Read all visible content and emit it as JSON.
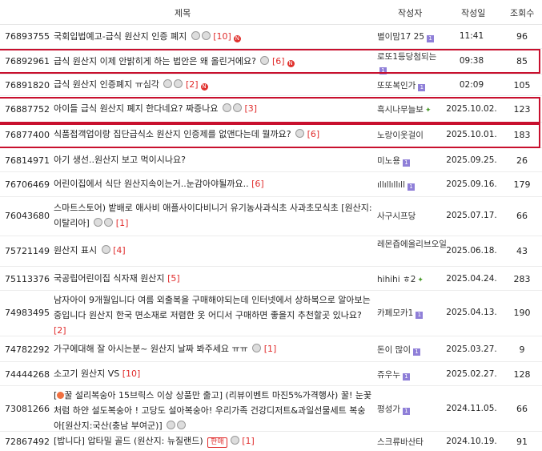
{
  "header": {
    "title": "제목",
    "author": "작성자",
    "date": "작성일",
    "views": "조회수"
  },
  "rows": [
    {
      "num": "76893755",
      "title": "국회입법예고-급식 원산지 인증 폐지",
      "comments": "[10]",
      "author": "별이맘17 25",
      "date": "11:41",
      "views": "96"
    },
    {
      "num": "76892961",
      "title": "급식 원산지 이제 안밝히게 하는 법안은 왜 올린거에요?",
      "comments": "[6]",
      "author": "로또1등당첨되는",
      "date": "09:38",
      "views": "85"
    },
    {
      "num": "76891820",
      "title": "급식 원산지 인증폐지 ㅠ심각",
      "comments": "[2]",
      "author": "또또복인가",
      "date": "02:09",
      "views": "105"
    },
    {
      "num": "76887752",
      "title": "아이들 급식 원산지 폐지 한다네요? 짜증나요",
      "comments": "[3]",
      "author": "흑시나무늘보",
      "date": "2025.10.02.",
      "views": "123"
    },
    {
      "num": "76877400",
      "title": "식품접객업이랑 집단급식소 원산지 인증제를 없앤다는데 뭘까요?",
      "comments": "[6]",
      "author": "노랑이옷걸이",
      "date": "2025.10.01.",
      "views": "183"
    },
    {
      "num": "76814971",
      "title": "아기 생선..원산지 보고 먹이시나요?",
      "comments": "",
      "author": "미노용",
      "date": "2025.09.25.",
      "views": "26"
    },
    {
      "num": "76706469",
      "title": "어린이집에서 식단 원산지속이는거..눈감아야될까요..",
      "comments": "[6]",
      "author": "ıllıllıllıll",
      "date": "2025.09.16.",
      "views": "179"
    },
    {
      "num": "76043680",
      "title": "스마트스토어) 밭배로 애사비 애플사이다비니거 유기농사과식초 사과초모식초 [원산지:이탈리아]",
      "comments": "[1]",
      "author": "사구시프당",
      "date": "2025.07.17.",
      "views": "66"
    },
    {
      "num": "75721149",
      "title": "원산지 표시",
      "comments": "[4]",
      "author": "레몬즙에올리브오일",
      "date": "2025.06.18.",
      "views": "43"
    },
    {
      "num": "75113376",
      "title": "국공립어린이집 식자재 원산지",
      "comments": "[5]",
      "author": "hihihi ㅎ2",
      "date": "2025.04.24.",
      "views": "283"
    },
    {
      "num": "74983495",
      "title": "남자아이 9개월입니다 여름 외출복을 구매해야되는데 인터넷에서 상하복으로 알아보는중입니다 원산지 한국 면소재로 저렴한 옷 어디서 구매하면 좋을지 추천할곳 있나요?",
      "comments": "[2]",
      "author": "카페모카1",
      "date": "2025.04.13.",
      "views": "190"
    },
    {
      "num": "74782292",
      "title": "가구에대해 잘 아시는분~ 원산지 날짜 봐주세요 ㅠㅠ",
      "comments": "[1]",
      "author": "돈이 많이",
      "date": "2025.03.27.",
      "views": "9"
    },
    {
      "num": "74444268",
      "title": "소고기 원산지 VS",
      "comments": "[10]",
      "author": "쥬우누",
      "date": "2025.02.27.",
      "views": "128"
    },
    {
      "num": "73081266",
      "title": "꿀 설리복숭아 15브릭스 이상 상품만 출고] (리뷰이벤트 마진5%가격행사) 꿀! 눈꽃처럼 하얀 설도복숭아 ! 고당도 설아복숭아! 우리가족 건강디저트&과일선물세트 복숭아[원산지:국산(충남 부여군)]",
      "comments": "",
      "author": "평성가",
      "date": "2024.11.05.",
      "views": "66"
    },
    {
      "num": "72867492",
      "title": "[밥니다] 압타밀 골드 (원산지: 뉴질랜드)",
      "comments": "[1]",
      "author": "스크류바산타",
      "date": "2024.10.19.",
      "views": "91"
    }
  ],
  "badge_text": "판매"
}
